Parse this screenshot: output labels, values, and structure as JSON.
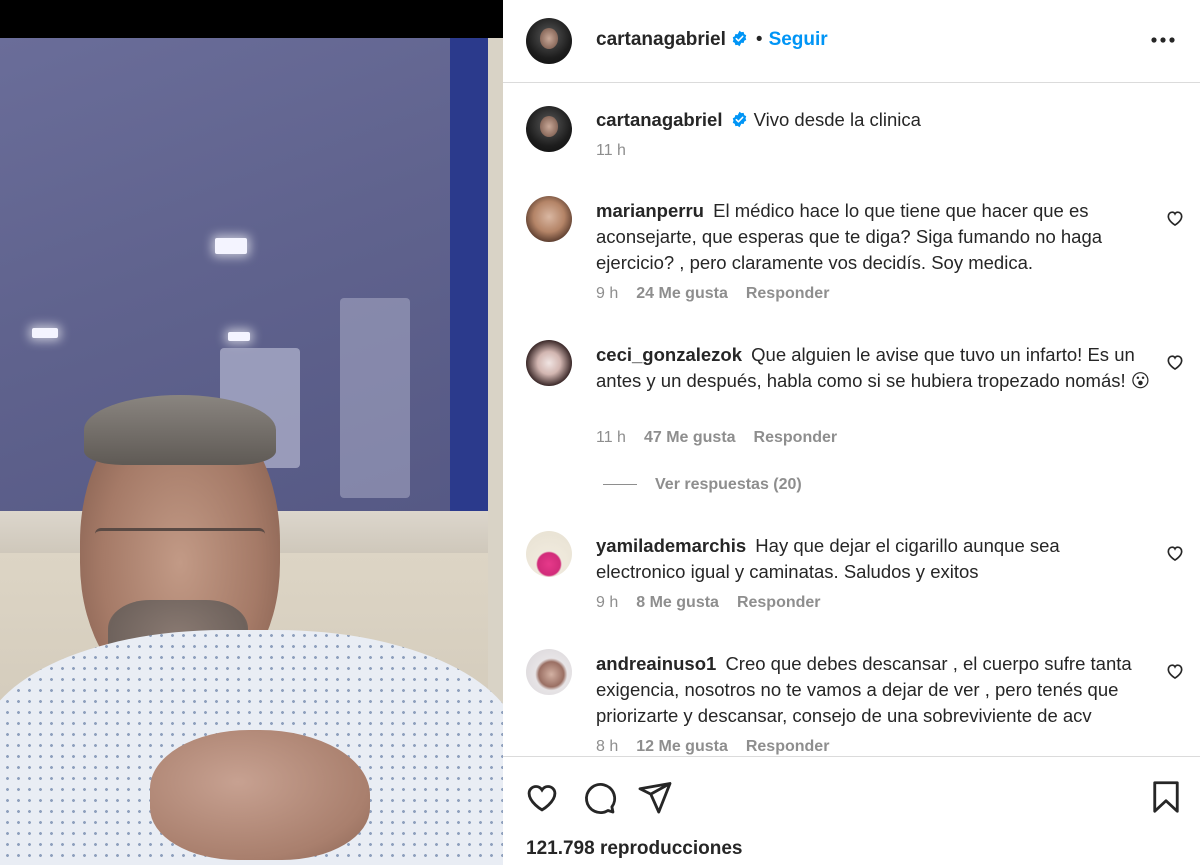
{
  "post": {
    "author": "cartanagabriel",
    "follow_label": "Seguir",
    "separator": "•",
    "caption": "Vivo desde la clinica",
    "caption_time": "11 h"
  },
  "comments": [
    {
      "user": "marianperru",
      "text": "El médico hace lo que tiene que hacer que es aconsejarte, que esperas que te diga? Siga fumando no haga ejercicio? , pero claramente vos decidís. Soy medica.",
      "time": "9 h",
      "likes": "24 Me gusta",
      "reply": "Responder"
    },
    {
      "user": "ceci_gonzalezok",
      "text": "Que alguien le avise que tuvo un infarto! Es un antes y un después, habla como si se hubiera tropezado nomás! 😮",
      "time": "11 h",
      "likes": "47 Me gusta",
      "reply": "Responder",
      "view_replies": "Ver respuestas (20)"
    },
    {
      "user": "yamilademarchis",
      "text": "Hay que dejar el cigarillo aunque sea electronico igual y caminatas. Saludos y exitos",
      "time": "9 h",
      "likes": "8 Me gusta",
      "reply": "Responder"
    },
    {
      "user": "andreainuso1",
      "text": "Creo que debes descansar , el cuerpo sufre tanta exigencia, nosotros no te vamos a dejar de ver , pero tenés que priorizarte y descansar, consejo de una sobreviviente de acv",
      "time": "8 h",
      "likes": "12 Me gusta",
      "reply": "Responder"
    }
  ],
  "footer": {
    "views": "121.798 reproducciones"
  },
  "icons": {
    "verified": "verified-badge-icon",
    "more": "more-options-icon",
    "like": "heart-icon",
    "comment": "comment-icon",
    "share": "share-icon",
    "save": "bookmark-icon"
  },
  "colors": {
    "link_blue": "#0095f6",
    "text_primary": "#262626",
    "text_secondary": "#8e8e8e",
    "divider": "#dbdbdb"
  }
}
